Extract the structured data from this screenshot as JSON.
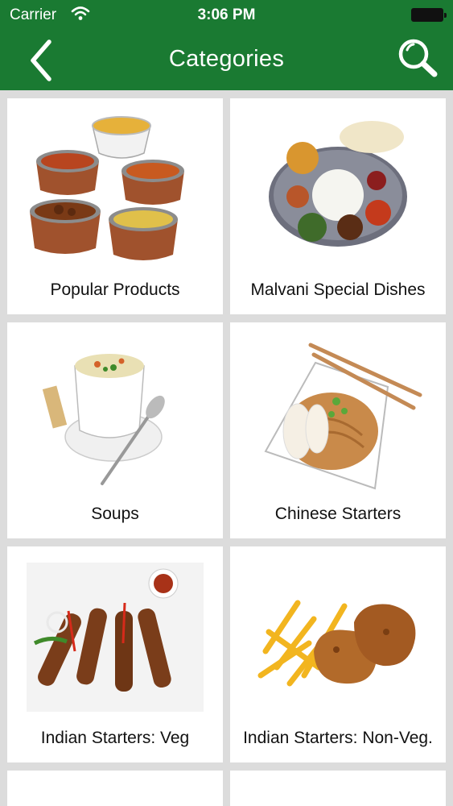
{
  "status_bar": {
    "carrier": "Carrier",
    "time": "3:06 PM",
    "wifi_icon": "wifi-icon",
    "battery_icon": "battery-icon"
  },
  "nav": {
    "title": "Categories",
    "back_icon": "chevron-left-icon",
    "search_icon": "search-icon",
    "color": "#1a7a32"
  },
  "categories": [
    {
      "label": "Popular Products",
      "image": "curry-bowls-image"
    },
    {
      "label": "Malvani Special Dishes",
      "image": "thali-platter-image"
    },
    {
      "label": "Soups",
      "image": "soup-cup-image"
    },
    {
      "label": "Chinese Starters",
      "image": "noodles-plate-image"
    },
    {
      "label": "Indian Starters: Veg",
      "image": "kebab-skewers-image"
    },
    {
      "label": "Indian Starters: Non-Veg.",
      "image": "fried-chicken-fries-image"
    }
  ]
}
